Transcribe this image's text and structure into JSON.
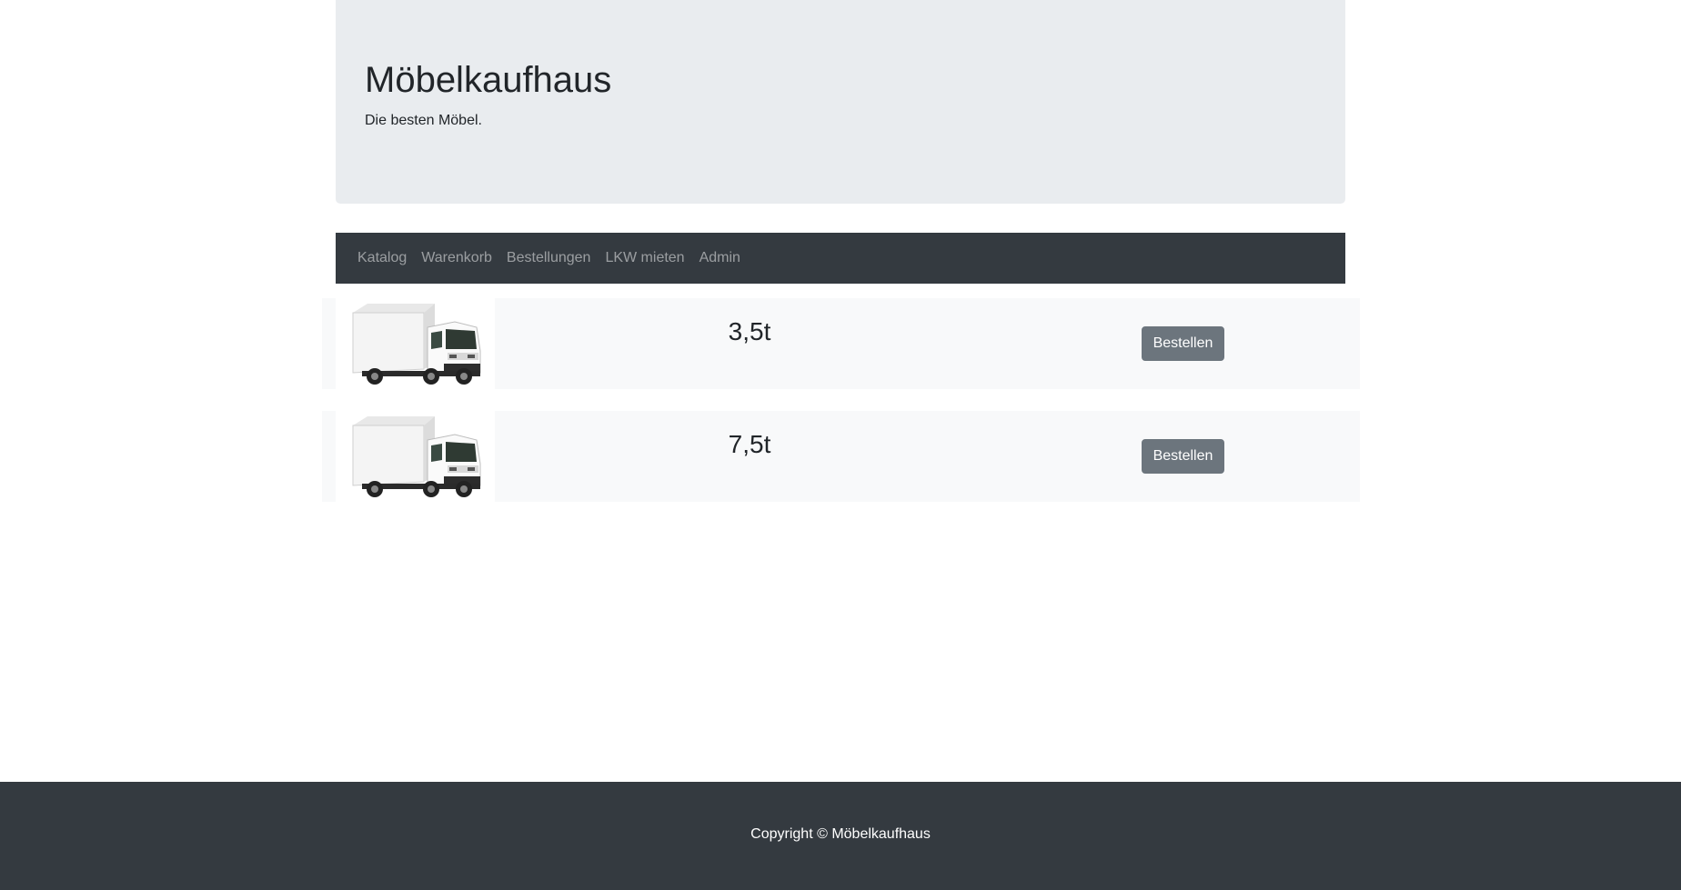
{
  "header": {
    "title": "Möbelkaufhaus",
    "subtitle": "Die besten Möbel."
  },
  "nav": {
    "items": [
      {
        "label": "Katalog"
      },
      {
        "label": "Warenkorb"
      },
      {
        "label": "Bestellungen"
      },
      {
        "label": "LKW mieten"
      },
      {
        "label": "Admin"
      }
    ]
  },
  "trucks": [
    {
      "label": "3,5t",
      "button_label": "Bestellen",
      "icon": "truck-image"
    },
    {
      "label": "7,5t",
      "button_label": "Bestellen",
      "icon": "truck-image"
    }
  ],
  "footer": {
    "text": "Copyright © Möbelkaufhaus"
  },
  "colors": {
    "header_bg": "#e9ecef",
    "navbar_bg": "#343a40",
    "button_bg": "#6c757d",
    "row_bg": "#f8f9fa",
    "footer_bg": "#343a40"
  }
}
